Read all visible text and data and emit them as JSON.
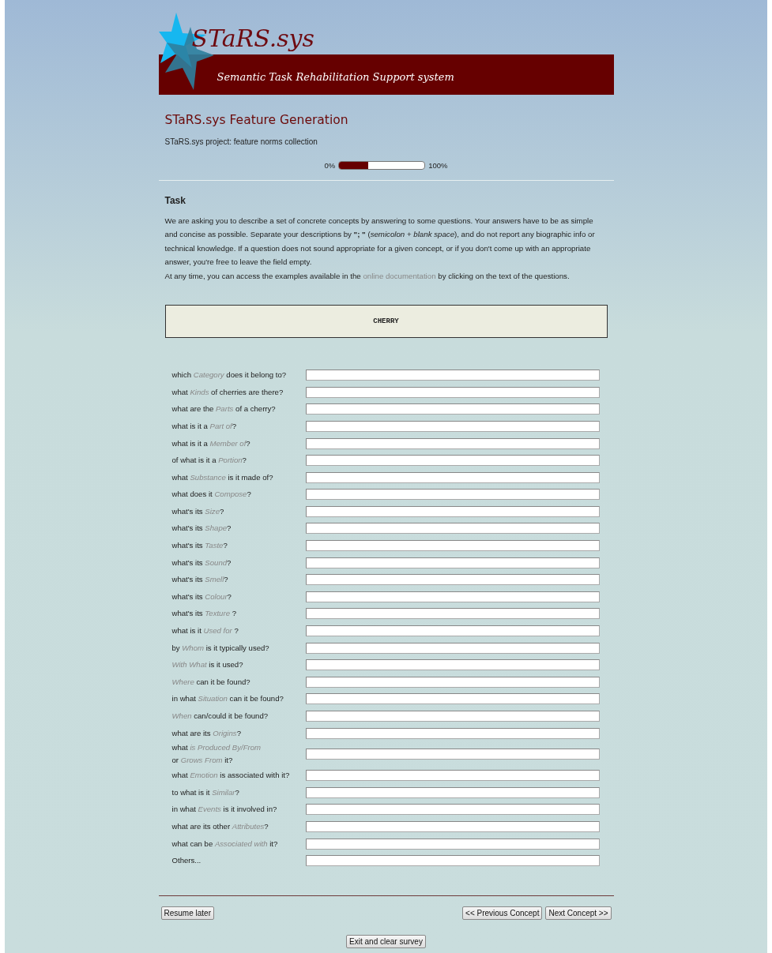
{
  "header": {
    "logo_text": "STaRS.sys",
    "tagline": "Semantic Task Rehabilitation Support system"
  },
  "title": "STaRS.sys Feature Generation",
  "subtitle": "STaRS.sys project: feature norms collection",
  "progress": {
    "start_label": "0%",
    "end_label": "100%",
    "level": 0.34
  },
  "task": {
    "heading": "Task",
    "paragraphs": [
      "We are asking you to describe a set of concrete concepts by answering to some questions. Your answers have to be as simple and concise as possible. Separate your descriptions by **\"; \"** (*semicolon* + *blank space*), and do not report any biographic info or technical knowledge. If a question does not sound appropriate for a given concept, or if you don't come up with an appropriate answer, you're free to leave the field empty."
    ],
    "doc_line": {
      "before": "At any time, you can access the examples available in the",
      "link": "online documentation",
      "after": "by clicking on the text of the questions."
    }
  },
  "concept": "CHERRY",
  "questions": [
    {
      "label": "which *Category* does it belong to?"
    },
    {
      "label": "what *Kinds* of cherries are there?"
    },
    {
      "label": "what are the *Parts* of a cherry?"
    },
    {
      "label": "what is it a *Part of*?"
    },
    {
      "label": "what is it a *Member of*?"
    },
    {
      "label": "of what is it a *Portion*?"
    },
    {
      "label": "what *Substance* is it made of?"
    },
    {
      "label": "what does it *Compose*?"
    },
    {
      "label": "what's its *Size*?"
    },
    {
      "label": "what's its *Shape*?"
    },
    {
      "label": "what's its *Taste*?"
    },
    {
      "label": "what's its *Sound*?"
    },
    {
      "label": "what's its *Smell*?"
    },
    {
      "label": "what's its *Colour*?"
    },
    {
      "label": "what's its *Texture* ?"
    },
    {
      "label": "what is it *Used for* ?"
    },
    {
      "label": "by *Whom* is it typically used?"
    },
    {
      "label": "*With What* is it used?"
    },
    {
      "label": "*Where* can it be found?"
    },
    {
      "label": "in what *Situation* can it be found?"
    },
    {
      "label": "*When* can/could it be found?"
    },
    {
      "label": "what are its *Origins*?"
    },
    {
      "label": "what *is Produced By/From*\nor *Grows From* it?"
    },
    {
      "label": "what *Emotion* is associated with it?"
    },
    {
      "label": "to what is it *Similar*?"
    },
    {
      "label": "in what *Events* is it involved in?"
    },
    {
      "label": "what are its other *Attributes*?"
    },
    {
      "label": "what can be *Associated with* it?"
    },
    {
      "label": "Others..."
    }
  ],
  "buttons": {
    "resume": "Resume later",
    "previous": "<< Previous Concept",
    "next": "Next Concept >>",
    "exit": "Exit and clear survey"
  }
}
